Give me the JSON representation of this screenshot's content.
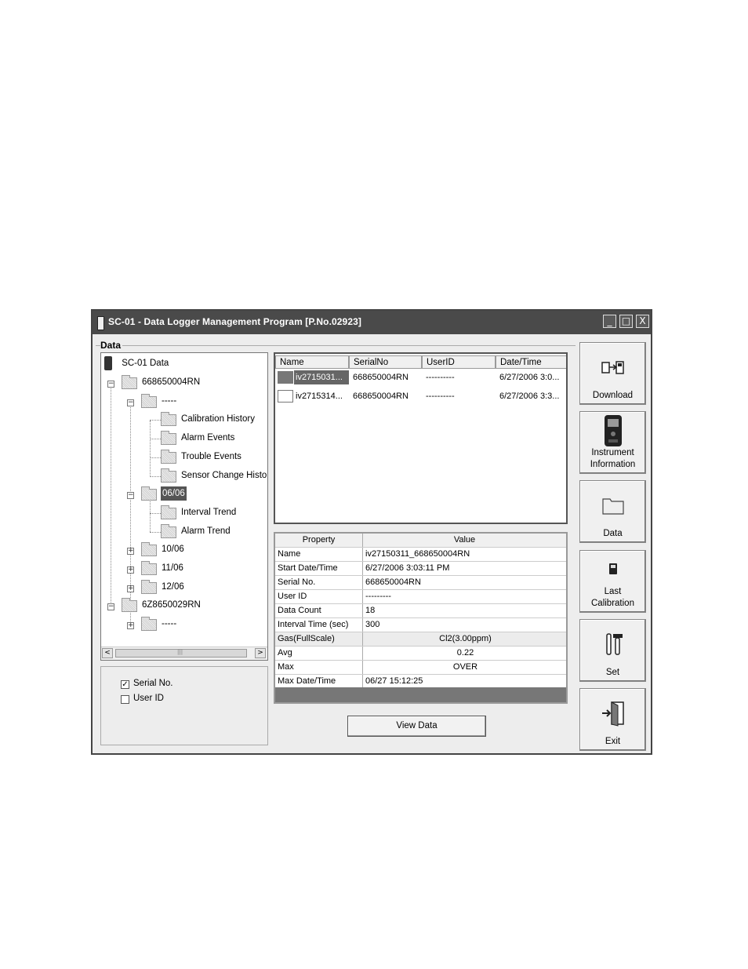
{
  "window": {
    "title": "SC-01 - Data Logger Management Program [P.No.02923]",
    "minimize_glyph": "_",
    "maximize_glyph": "□",
    "close_glyph": "X"
  },
  "data_group": {
    "label": "Data"
  },
  "tree": {
    "root": "SC-01 Data",
    "device1": "668650004RN",
    "dash_folder": "-----",
    "calibration_history": "Calibration History",
    "alarm_events": "Alarm Events",
    "trouble_events": "Trouble Events",
    "sensor_change": "Sensor Change Histo",
    "month_0606": "06/06",
    "interval_trend": "Interval Trend",
    "alarm_trend": "Alarm Trend",
    "month_1006": "10/06",
    "month_1106": "11/06",
    "month_1206": "12/06",
    "device2": "6Z8650029RN",
    "device2_dash": "-----",
    "plus": "+",
    "minus": "−",
    "scroll_left": "<",
    "scroll_right": ">",
    "scroll_grip": "|||"
  },
  "options": {
    "serial_no": {
      "label": "Serial No.",
      "checked": true,
      "mark": "✓"
    },
    "user_id": {
      "label": "User ID",
      "checked": false
    }
  },
  "file_list": {
    "headers": [
      "Name",
      "SerialNo",
      "UserID",
      "Date/Time"
    ],
    "rows": [
      {
        "name": "iv2715031...",
        "serial": "668650004RN",
        "user": "----------",
        "datetime": "6/27/2006 3:0..."
      },
      {
        "name": "iv2715314...",
        "serial": "668650004RN",
        "user": "----------",
        "datetime": "6/27/2006 3:3..."
      }
    ]
  },
  "properties": {
    "headers": [
      "Property",
      "Value"
    ],
    "rows": [
      {
        "property": "Name",
        "value": "iv27150311_668650004RN"
      },
      {
        "property": "Start Date/Time",
        "value": "6/27/2006 3:03:11 PM"
      },
      {
        "property": "Serial No.",
        "value": "668650004RN"
      },
      {
        "property": "User ID",
        "value": "---------"
      },
      {
        "property": "Data Count",
        "value": "18"
      },
      {
        "property": "Interval Time (sec)",
        "value": "300"
      },
      {
        "property": "Gas(FullScale)",
        "value": "Cl2(3.00ppm)"
      },
      {
        "property": "Avg",
        "value": "0.22"
      },
      {
        "property": "Max",
        "value": "OVER"
      },
      {
        "property": "Max Date/Time",
        "value": "06/27 15:12:25"
      }
    ]
  },
  "buttons": {
    "view_data": "View Data",
    "download": "Download",
    "instrument_line1": "Instrument",
    "instrument_line2": "Information",
    "data": "Data",
    "last_cal_line1": "Last",
    "last_cal_line2": "Calibration",
    "set": "Set",
    "exit": "Exit"
  }
}
